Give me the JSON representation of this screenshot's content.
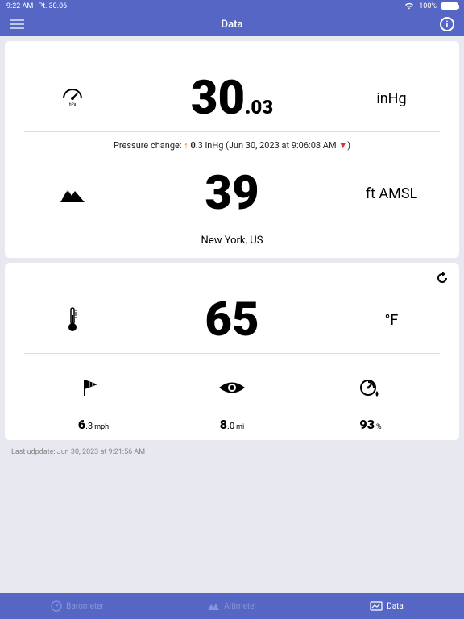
{
  "status": {
    "time": "9:22 AM",
    "day": "Pt. 30.06",
    "battery": "100%"
  },
  "header": {
    "title": "Data"
  },
  "card1": {
    "pressure": {
      "main": "30",
      "dec": ".03",
      "unit": "inHg"
    },
    "change": {
      "label": "Pressure change: ",
      "delta_main": "0",
      "delta_dec": ".3 inHg (Jun 30, 2023 at 9:06:08 AM ",
      "tail": ")"
    },
    "altitude": {
      "main": "39",
      "dec": "",
      "unit": "ft AMSL"
    },
    "location": "New York, US"
  },
  "card2": {
    "temperature": {
      "main": "65",
      "dec": "",
      "unit": "°F"
    },
    "wind": {
      "main": "6",
      "dec": ".3",
      "unit": "mph"
    },
    "visibility": {
      "main": "8",
      "dec": ".0",
      "unit": "mi"
    },
    "humidity": {
      "main": "93",
      "dec": "",
      "unit": "%"
    }
  },
  "footer_note": "Last udpdate: Jun 30, 2023 at 9:21:56 AM",
  "tabs": {
    "barometer": "Barometer",
    "altimeter": "Altimeter",
    "data": "Data"
  }
}
